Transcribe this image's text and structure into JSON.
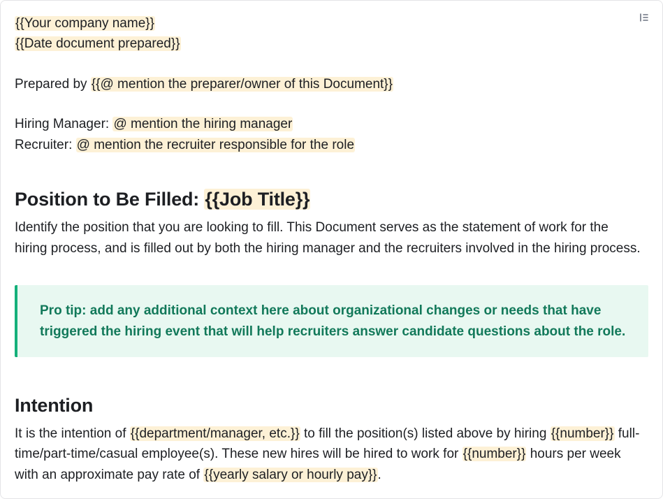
{
  "header": {
    "company_placeholder": "{{Your company name}}",
    "date_placeholder": "{{Date document prepared}}",
    "prepared_by_label": "Prepared by ",
    "prepared_by_placeholder": "{{@ mention the preparer/owner of this Document}}",
    "hiring_manager_label": "Hiring Manager: ",
    "hiring_manager_placeholder": "@ mention the hiring manager",
    "recruiter_label": "Recruiter: ",
    "recruiter_placeholder": "@ mention the recruiter responsible for the role"
  },
  "position": {
    "heading_prefix": "Position to Be Filled: ",
    "job_title_placeholder": "{{Job Title}}",
    "description": "Identify the position that you are looking to fill. This Document serves as the statement of work for the hiring process, and is filled out by both the hiring manager and the recruiters involved in the hiring process."
  },
  "callout": {
    "text": "Pro tip: add any additional context here about organizational changes or needs that have triggered the hiring event that will help recruiters answer candidate questions about the role."
  },
  "intention": {
    "heading": "Intention",
    "t1": "It is the intention of ",
    "p1": "{{department/manager, etc.}}",
    "t2": " to fill the position(s) listed above by hiring ",
    "p2": "{{number}}",
    "t3": " full-time/part-time/casual employee(s). These new hires will be hired to work for ",
    "p3": "{{number}}",
    "t4": " hours per week with an approximate pay rate of ",
    "p4": "{{yearly salary or hourly pay}}",
    "t5": "."
  }
}
